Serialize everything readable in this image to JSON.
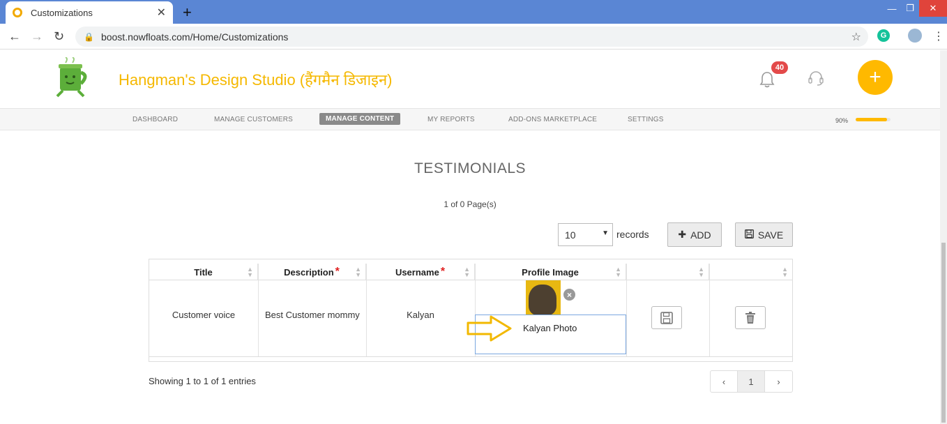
{
  "browser": {
    "tab_title": "Customizations",
    "url": "boost.nowfloats.com/Home/Customizations",
    "extension_letter": "G"
  },
  "app": {
    "brand_name": "Hangman's Design Studio (हैंगमैन डिजाइन)",
    "notification_count": "40",
    "nav_items": [
      "DASHBOARD",
      "MANAGE CUSTOMERS",
      "MANAGE CONTENT",
      "MY REPORTS",
      "ADD-ONS MARKETPLACE",
      "SETTINGS"
    ],
    "active_nav": "MANAGE CONTENT",
    "profile_progress_label": "90%",
    "profile_progress": 0.9,
    "accent_color": "#ffb900"
  },
  "page": {
    "title": "TESTIMONIALS",
    "page_info": "1 of 0 Page(s)",
    "records_per_page": "10",
    "records_label": "records",
    "add_label": "ADD",
    "save_label": "SAVE"
  },
  "table": {
    "columns": [
      {
        "label": "Title",
        "required": false
      },
      {
        "label": "Description",
        "required": true
      },
      {
        "label": "Username",
        "required": true
      },
      {
        "label": "Profile Image",
        "required": false
      },
      {
        "label": "",
        "required": false
      },
      {
        "label": "",
        "required": false
      }
    ],
    "rows": [
      {
        "title": "Customer voice",
        "description": "Best Customer mommy",
        "username": "Kalyan",
        "profile_image_caption": "Kalyan Photo"
      }
    ]
  },
  "footer": {
    "showing": "Showing 1 to 1 of 1 entries",
    "prev": "‹",
    "current_page": "1",
    "next": "›"
  }
}
